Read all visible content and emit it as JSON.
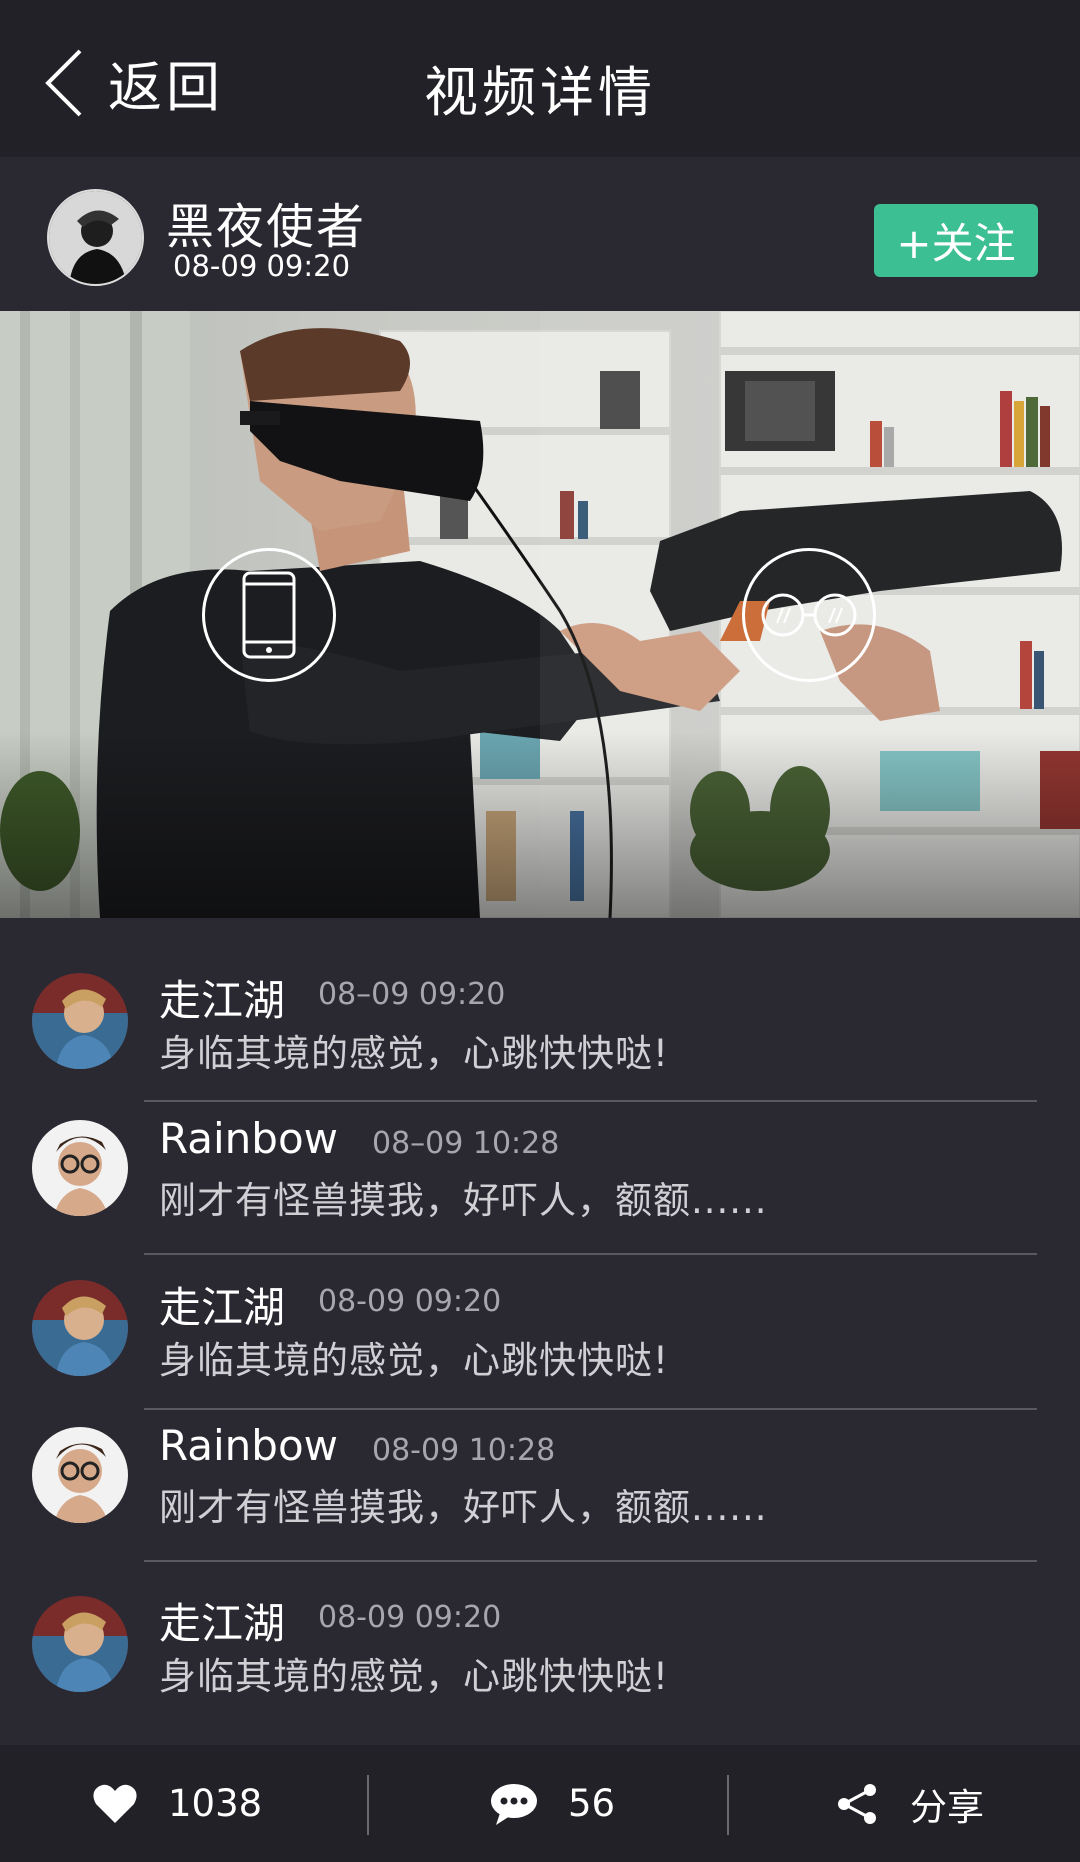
{
  "header": {
    "back_label": "返回",
    "title": "视频详情"
  },
  "author": {
    "name": "黑夜使者",
    "time": "08-09 09:20",
    "follow_label": "+关注"
  },
  "video": {
    "left_mode_icon": "phone-icon",
    "right_mode_icon": "vr-glasses-icon"
  },
  "comments": [
    {
      "name": "走江湖",
      "time": "08–09  09:20",
      "text": "身临其境的感觉，心跳快快哒!"
    },
    {
      "name": "Rainbow",
      "time": "08–09  10:28",
      "text": "刚才有怪兽摸我，好吓人，额额......"
    },
    {
      "name": "走江湖",
      "time": "08-09  09:20",
      "text": "身临其境的感觉，心跳快快哒!"
    },
    {
      "name": "Rainbow",
      "time": "08-09  10:28",
      "text": "刚才有怪兽摸我，好吓人，额额......"
    },
    {
      "name": "走江湖",
      "time": "08-09  09:20",
      "text": "身临其境的感觉，心跳快快哒!"
    }
  ],
  "bottom": {
    "like_count": "1038",
    "comment_count": "56",
    "share_label": "分享"
  },
  "colors": {
    "background": "#2a2932",
    "topbar": "#222127",
    "accent": "#3dbf94"
  }
}
